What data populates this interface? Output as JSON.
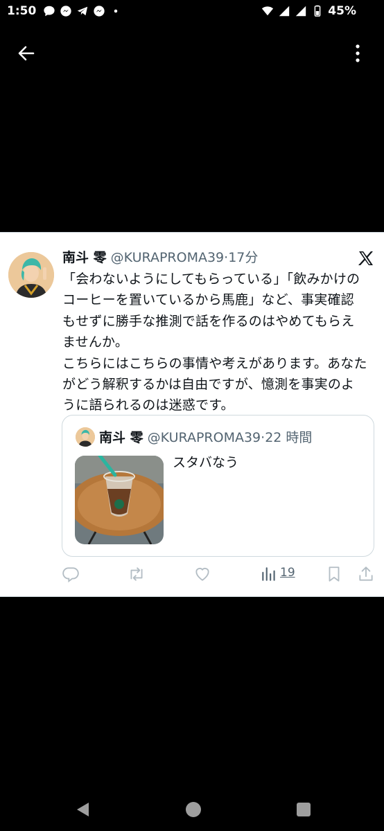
{
  "status": {
    "time": "1:50",
    "battery": "45%"
  },
  "tweet": {
    "author_name": "南斗 零",
    "handle": "@KURAPROMA39",
    "separator": "·",
    "time": "17分",
    "text": "「会わないようにしてもらっている」「飲みかけのコーヒーを置いているから馬鹿」など、事実確認もせずに勝手な推測で話を作るのはやめてもらえませんか。\nこちらにはこちらの事情や考えがあります。あなたがどう解釈するかは自由ですが、憶測を事実のように語られるのは迷惑です。"
  },
  "quote": {
    "author_name": "南斗 零",
    "handle": "@KURAPROMA39",
    "separator": "·",
    "time": "22 時間",
    "text": "スタバなう"
  },
  "actions": {
    "views": "19"
  },
  "icons": {
    "back": "arrow-left-icon",
    "more": "more-vertical-icon",
    "platform": "x-logo-icon",
    "reply": "reply-icon",
    "retweet": "retweet-icon",
    "like": "heart-icon",
    "views": "views-bar-icon",
    "bookmark": "bookmark-icon",
    "share": "share-icon"
  },
  "colors": {
    "text": "#0f1419",
    "secondary": "#536471",
    "border": "#cfd9de",
    "background": "#000000"
  }
}
